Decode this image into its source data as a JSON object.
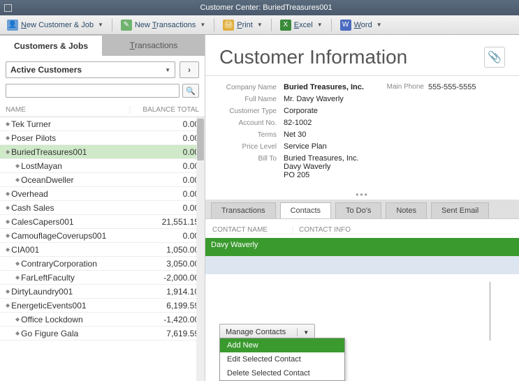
{
  "titlebar": {
    "title": "Customer Center: BuriedTreasures001"
  },
  "toolbar": {
    "new_customer": "New Customer & Job",
    "new_trans": "New Transactions",
    "print": "Print",
    "excel": "Excel",
    "word": "Word"
  },
  "left_tabs": {
    "customers": "Customers & Jobs",
    "transactions": "Transactions"
  },
  "filter": {
    "label": "Active Customers"
  },
  "search": {
    "placeholder": ""
  },
  "list_headers": {
    "name": "NAME",
    "balance": "BALANCE TOTAL"
  },
  "rows": [
    {
      "name": "Tek Turner",
      "bal": "0.00",
      "indent": false
    },
    {
      "name": "Poser Pilots",
      "bal": "0.00",
      "indent": false
    },
    {
      "name": "BuriedTreasures001",
      "bal": "0.00",
      "indent": false,
      "selected": true
    },
    {
      "name": "LostMayan",
      "bal": "0.00",
      "indent": true
    },
    {
      "name": "OceanDweller",
      "bal": "0.00",
      "indent": true
    },
    {
      "name": "Overhead",
      "bal": "0.00",
      "indent": false
    },
    {
      "name": "Cash Sales",
      "bal": "0.00",
      "indent": false
    },
    {
      "name": "CalesCapers001",
      "bal": "21,551.15",
      "indent": false
    },
    {
      "name": "CamouflageCoverups001",
      "bal": "0.00",
      "indent": false
    },
    {
      "name": "CIA001",
      "bal": "1,050.00",
      "indent": false
    },
    {
      "name": "ContraryCorporation",
      "bal": "3,050.00",
      "indent": true
    },
    {
      "name": "FarLeftFaculty",
      "bal": "-2,000.00",
      "indent": true
    },
    {
      "name": "DirtyLaundry001",
      "bal": "1,914.10",
      "indent": false
    },
    {
      "name": "EnergeticEvents001",
      "bal": "6,199.59",
      "indent": false
    },
    {
      "name": "Office Lockdown",
      "bal": "-1,420.00",
      "indent": true
    },
    {
      "name": "Go Figure Gala",
      "bal": "7,619.59",
      "indent": true
    }
  ],
  "heading": "Customer Information",
  "info": {
    "company_lbl": "Company Name",
    "company": "Buried Treasures, Inc.",
    "fullname_lbl": "Full Name",
    "fullname": "Mr. Davy  Waverly",
    "custtype_lbl": "Customer Type",
    "custtype": "Corporate",
    "acct_lbl": "Account No.",
    "acct": "82-1002",
    "terms_lbl": "Terms",
    "terms": "Net 30",
    "pricelevel_lbl": "Price Level",
    "pricelevel": "Service Plan",
    "billto_lbl": "Bill To",
    "billto1": "Buried Treasures, Inc.",
    "billto2": "Davy Waverly",
    "billto3": "PO 205",
    "phone_lbl": "Main Phone",
    "phone": "555-555-5555"
  },
  "rtabs": {
    "trans": "Transactions",
    "contacts": "Contacts",
    "todos": "To Do's",
    "notes": "Notes",
    "email": "Sent Email"
  },
  "contacts_hdr": {
    "name": "CONTACT NAME",
    "info": "CONTACT INFO"
  },
  "contact_row": {
    "name": "Davy Waverly"
  },
  "manage_label": "Manage Contacts",
  "menu": {
    "add": "Add New",
    "edit": "Edit Selected Contact",
    "del": "Delete Selected Contact"
  }
}
